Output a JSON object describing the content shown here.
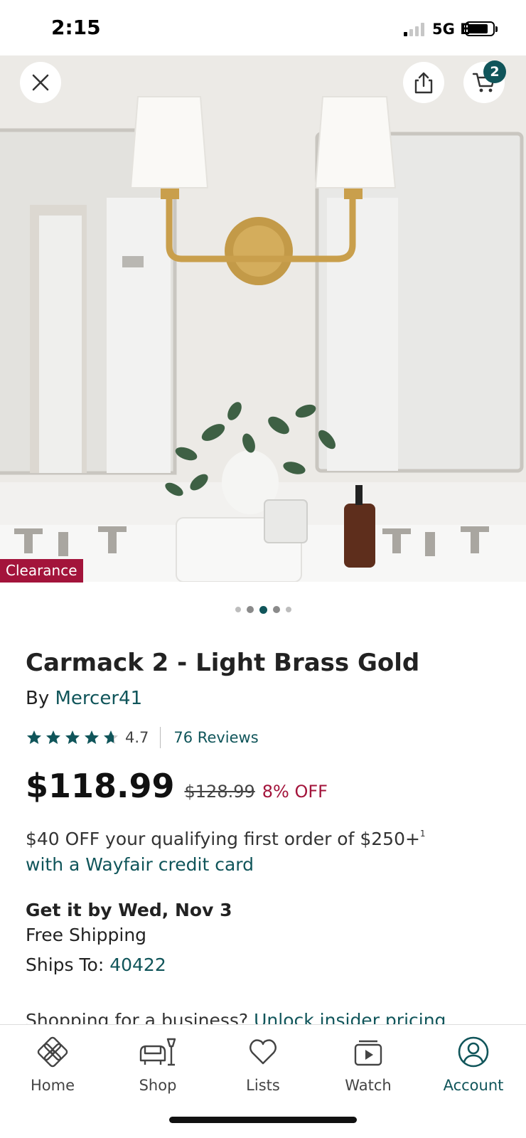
{
  "status_bar": {
    "time": "2:15",
    "network": "5G E"
  },
  "header": {
    "cart_count": "2",
    "close_icon": "close-icon",
    "share_icon": "share-icon",
    "cart_icon": "cart-icon"
  },
  "gallery": {
    "badge": "Clearance",
    "image_count": 5,
    "active_index": 2
  },
  "product": {
    "title": "Carmack 2 - Light Brass Gold",
    "by_label": "By",
    "brand": "Mercer41",
    "rating": "4.7",
    "rating_value": 4.7,
    "reviews": "76 Reviews",
    "price": "$118.99",
    "was_price": "$128.99",
    "discount": "8% OFF"
  },
  "promo": {
    "text": "$40 OFF your qualifying first order of $250+",
    "footnote": "1",
    "link": "with a Wayfair credit card"
  },
  "delivery": {
    "eta": "Get it by Wed, Nov 3",
    "shipping": "Free Shipping",
    "ships_to_label": "Ships To:",
    "zip": "40422"
  },
  "business": {
    "text": "Shopping for a business?",
    "link": "Unlock insider pricing"
  },
  "nav": {
    "items": [
      {
        "label": "Home",
        "icon": "home-icon"
      },
      {
        "label": "Shop",
        "icon": "shop-icon"
      },
      {
        "label": "Lists",
        "icon": "heart-icon"
      },
      {
        "label": "Watch",
        "icon": "watch-icon"
      },
      {
        "label": "Account",
        "icon": "account-icon"
      }
    ],
    "active": "Account"
  },
  "colors": {
    "brand": "#10555a",
    "sale": "#a3143b"
  }
}
